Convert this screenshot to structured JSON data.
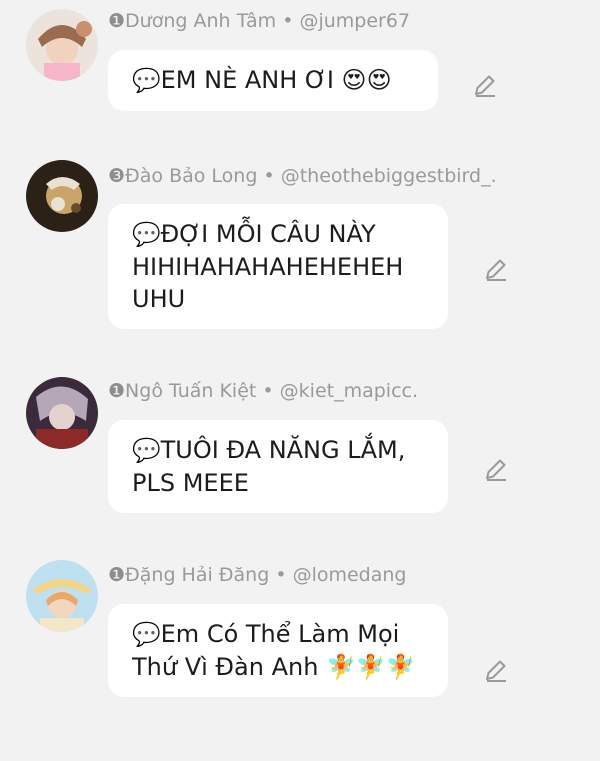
{
  "comments": [
    {
      "rank": "❶",
      "name": "Dương Anh Tâm",
      "sep": " • ",
      "handle": "@jumper67",
      "speech": "💬",
      "text": "EM NÈ ANH ƠI 😍😍",
      "avatar_colors": [
        "#e9c6b6",
        "#a8785e",
        "#f4b6c8"
      ]
    },
    {
      "rank": "❸",
      "name": "Đào Bảo Long",
      "sep": " • ",
      "handle": "@theothebiggestbird_.",
      "speech": "💬",
      "text": "ĐỢI MỖI CÂU NÀY HIHIHAHAHAHEHEHEH UHU",
      "avatar_colors": [
        "#2b2116",
        "#c9a56a",
        "#e8e2d4"
      ]
    },
    {
      "rank": "❶",
      "name": "Ngô Tuấn Kiệt",
      "sep": " • ",
      "handle": "@kiet_mapicc.",
      "speech": "💬",
      "text": "TUÔI ĐA NĂNG LẮM, PLS MEEE",
      "avatar_colors": [
        "#3a2a3c",
        "#b5a7b8",
        "#8c2a2a"
      ]
    },
    {
      "rank": "❶",
      "name": "Đặng Hải Đăng",
      "sep": " • ",
      "handle": "@lomedang",
      "speech": "💬",
      "text": "Em Có Thể Làm Mọi Thứ Vì Đàn Anh 🧚🧚🧚",
      "avatar_colors": [
        "#bfe0f0",
        "#f1d58a",
        "#e8a86a"
      ]
    }
  ],
  "icons": {
    "edit": "pencil-edit-icon",
    "speech": "speech-balloon-icon"
  }
}
